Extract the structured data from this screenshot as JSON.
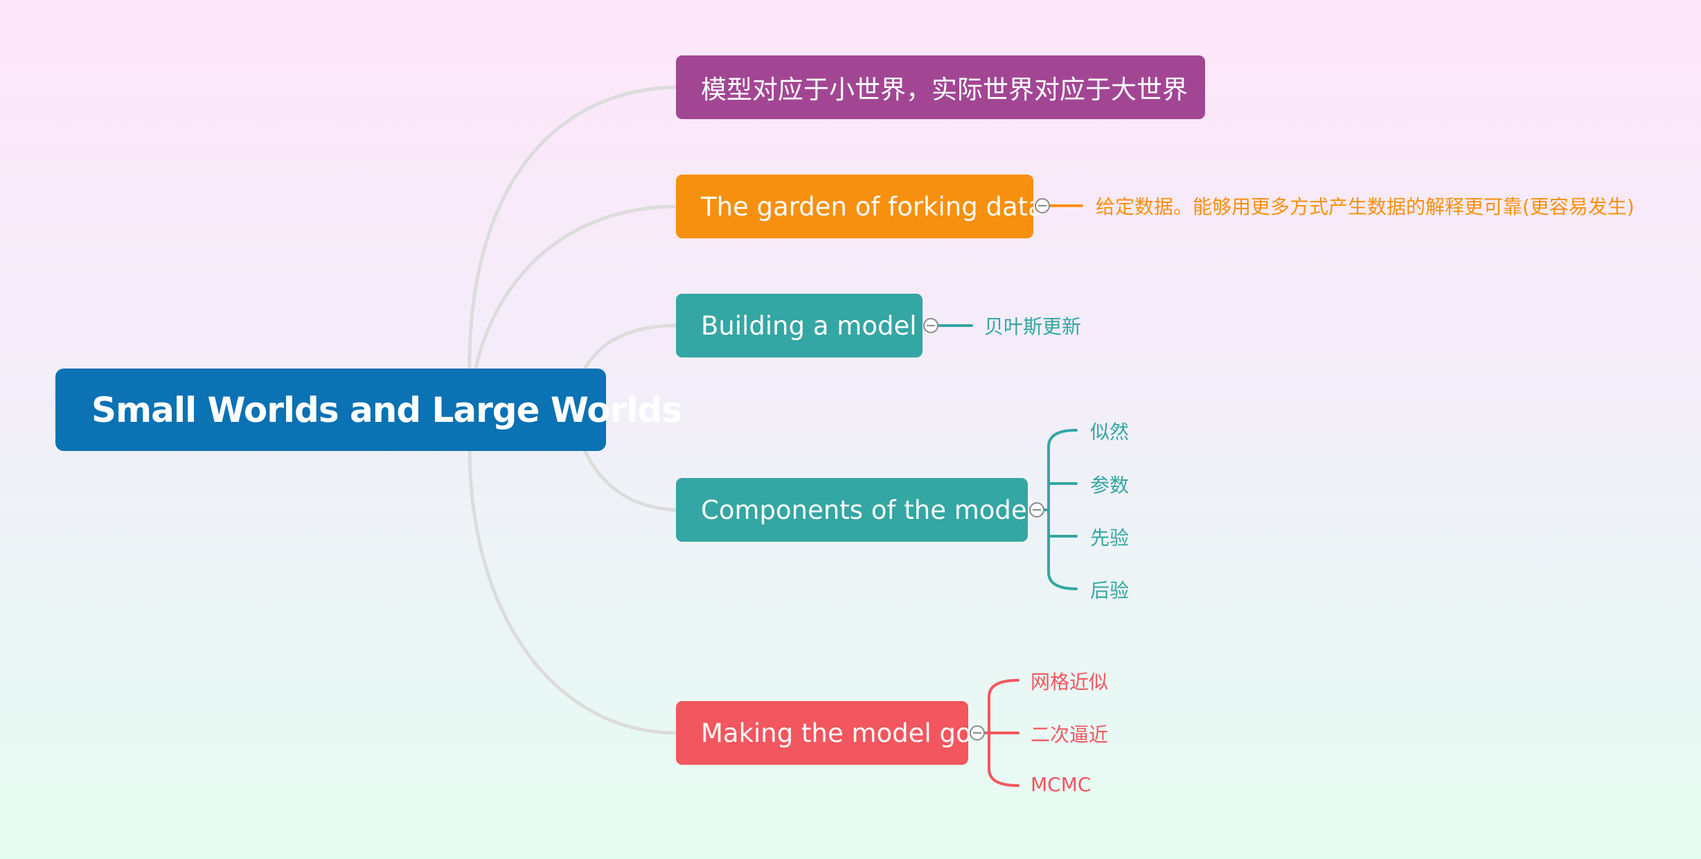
{
  "root": {
    "label": "Small Worlds and Large Worlds",
    "color": "#0b72b3"
  },
  "branches": [
    {
      "label": "模型对应于小世界，实际世界对应于大世界",
      "color": "#a24694",
      "children": []
    },
    {
      "label": "The garden of forking data",
      "color": "#f7900f",
      "children": [
        "给定数据。能够用更多方式产生数据的解释更可靠(更容易发生)"
      ]
    },
    {
      "label": "Building a model",
      "color": "#34a6a3",
      "children": [
        "贝叶斯更新"
      ]
    },
    {
      "label": "Components of the model",
      "color": "#34a6a3",
      "children": [
        "似然",
        "参数",
        "先验",
        "后验"
      ]
    },
    {
      "label": "Making the model go",
      "color": "#f2565e",
      "children": [
        "网格近似",
        "二次逼近",
        "MCMC"
      ]
    }
  ],
  "connector_color": "#dcdcdc",
  "collapse_icon": "minus-circle-icon"
}
